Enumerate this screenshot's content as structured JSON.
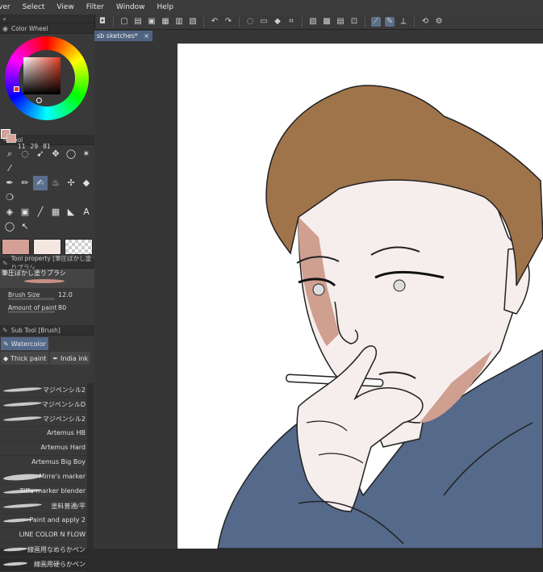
{
  "menu": [
    "ver",
    "Select",
    "View",
    "Filter",
    "Window",
    "Help"
  ],
  "panels": {
    "color_wheel": "Color Wheel",
    "tool": "Tool",
    "tool_property": "Tool property [筆圧ぼかし塗りブラシ",
    "sub_tool": "Sub Tool [Brush]"
  },
  "color": {
    "h": "11",
    "s": "29",
    "v": "81",
    "main": "#d4a095"
  },
  "brush": {
    "name": "筆圧ぼかし塗りブラシ",
    "size_label": "Brush Size",
    "size_value": "12.0",
    "paint_label": "Amount of paint",
    "paint_value": "80"
  },
  "subtool_tabs": [
    "Watercolor",
    "Thick paint",
    "India ink"
  ],
  "brush_list": [
    "マジペンシル2",
    "マジペンシルD",
    "マジペンシル2",
    "Artemus HB",
    "Artemus Hard",
    "Artemus Big Boy",
    "Mirre's marker",
    "Tiffa marker blender",
    "塗料普通/平",
    "Paint and apply 2",
    "LINE COLOR N FLOW",
    "線画用なめらかペン",
    "線画用硬らかペン"
  ],
  "document": {
    "tab": "sb sketches*",
    "close": "×"
  },
  "colors": {
    "accent": "#5a6f8d",
    "hair": "#a0744a",
    "skin": "#f6eeec",
    "shade": "#cf9f90",
    "shirt": "#55698a"
  }
}
